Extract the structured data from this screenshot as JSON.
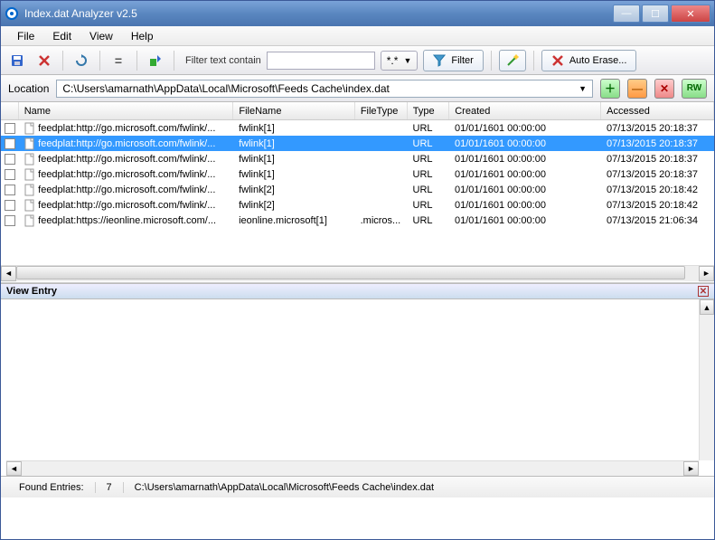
{
  "window": {
    "title": "Index.dat Analyzer v2.5"
  },
  "menu": {
    "file": "File",
    "edit": "Edit",
    "view": "View",
    "help": "Help"
  },
  "toolbar": {
    "filter_label": "Filter text contain",
    "filter_value": "",
    "pattern": "*.*",
    "filter_btn": "Filter",
    "autoerase": "Auto Erase..."
  },
  "location": {
    "label": "Location",
    "path": "C:\\Users\\amarnath\\AppData\\Local\\Microsoft\\Feeds Cache\\index.dat",
    "rw": "RW"
  },
  "columns": {
    "name": "Name",
    "filename": "FileName",
    "filetype": "FileType",
    "type": "Type",
    "created": "Created",
    "accessed": "Accessed"
  },
  "rows": [
    {
      "name": "feedplat:http://go.microsoft.com/fwlink/...",
      "filename": "fwlink[1]",
      "filetype": "",
      "type": "URL",
      "created": "01/01/1601   00:00:00",
      "accessed": "07/13/2015   20:18:37",
      "selected": false
    },
    {
      "name": "feedplat:http://go.microsoft.com/fwlink/...",
      "filename": "fwlink[1]",
      "filetype": "",
      "type": "URL",
      "created": "01/01/1601   00:00:00",
      "accessed": "07/13/2015   20:18:37",
      "selected": true
    },
    {
      "name": "feedplat:http://go.microsoft.com/fwlink/...",
      "filename": "fwlink[1]",
      "filetype": "",
      "type": "URL",
      "created": "01/01/1601   00:00:00",
      "accessed": "07/13/2015   20:18:37",
      "selected": false
    },
    {
      "name": "feedplat:http://go.microsoft.com/fwlink/...",
      "filename": "fwlink[1]",
      "filetype": "",
      "type": "URL",
      "created": "01/01/1601   00:00:00",
      "accessed": "07/13/2015   20:18:37",
      "selected": false
    },
    {
      "name": "feedplat:http://go.microsoft.com/fwlink/...",
      "filename": "fwlink[2]",
      "filetype": "",
      "type": "URL",
      "created": "01/01/1601   00:00:00",
      "accessed": "07/13/2015   20:18:42",
      "selected": false
    },
    {
      "name": "feedplat:http://go.microsoft.com/fwlink/...",
      "filename": "fwlink[2]",
      "filetype": "",
      "type": "URL",
      "created": "01/01/1601   00:00:00",
      "accessed": "07/13/2015   20:18:42",
      "selected": false
    },
    {
      "name": "feedplat:https://ieonline.microsoft.com/...",
      "filename": "ieonline.microsoft[1]",
      "filetype": ".micros...",
      "type": "URL",
      "created": "01/01/1601   00:00:00",
      "accessed": "07/13/2015   21:06:34",
      "selected": false
    }
  ],
  "viewentry": {
    "title": "View Entry"
  },
  "status": {
    "found_label": "Found Entries:",
    "count": "7",
    "path": "C:\\Users\\amarnath\\AppData\\Local\\Microsoft\\Feeds Cache\\index.dat"
  }
}
